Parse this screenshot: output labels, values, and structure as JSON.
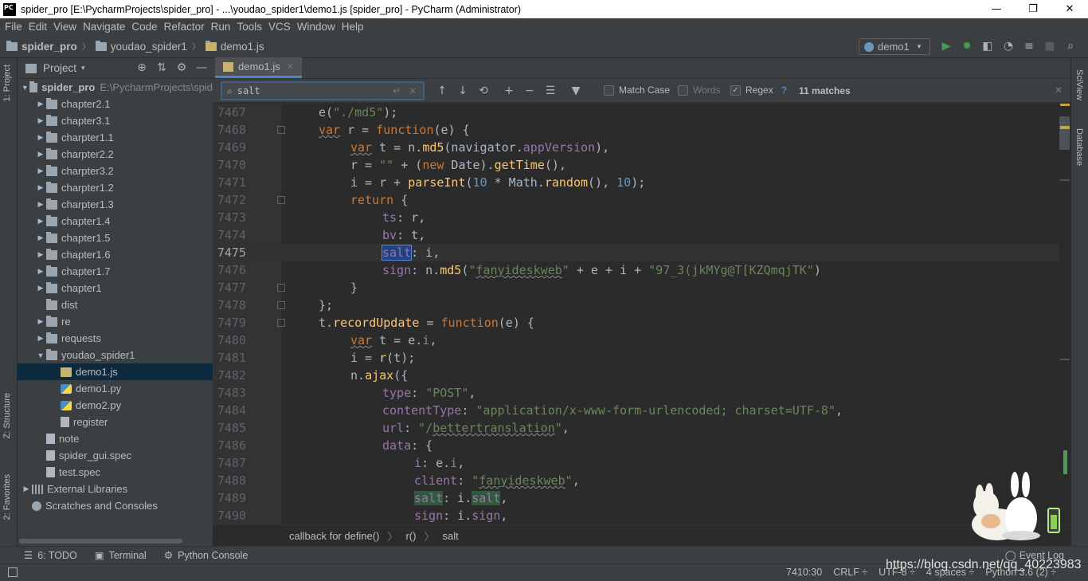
{
  "window": {
    "app_icon": "PC",
    "title": "spider_pro [E:\\PycharmProjects\\spider_pro] - ...\\youdao_spider1\\demo1.js [spider_pro] - PyCharm (Administrator)",
    "min": "—",
    "max": "❐",
    "close": "✕"
  },
  "menu": [
    "File",
    "Edit",
    "View",
    "Navigate",
    "Code",
    "Refactor",
    "Run",
    "Tools",
    "VCS",
    "Window",
    "Help"
  ],
  "breadcrumb": {
    "project": "spider_pro",
    "folder": "youdao_spider1",
    "file": "demo1.js",
    "sep": "〉"
  },
  "run_config": {
    "name": "demo1",
    "arrow": "▾"
  },
  "toolbar_icons": [
    "run-icon",
    "debug-icon",
    "coverage-icon",
    "profile-icon",
    "run-tasks-icon",
    "stop-icon",
    "search-everywhere-icon"
  ],
  "toolbar_glyphs": [
    "▶",
    "✹",
    "◧",
    "◔",
    "≡",
    "■",
    "⌕"
  ],
  "left_tabs": {
    "project": "1: Project",
    "structure": "Z: Structure",
    "favorites": "2: Favorites"
  },
  "right_tabs": {
    "sciview": "SciView",
    "database": "Database"
  },
  "project_panel": {
    "title": "Project",
    "arrow": "▾",
    "icons": [
      "⊕",
      "⇅",
      "⚙",
      "—"
    ]
  },
  "tree": [
    {
      "label": "spider_pro",
      "extra": "E:\\PycharmProjects\\spid",
      "level": 0,
      "arrow": "▼",
      "icon": "folder",
      "bold": true
    },
    {
      "label": "chapter2.1",
      "level": 1,
      "arrow": "▶",
      "icon": "folder"
    },
    {
      "label": "chapter3.1",
      "level": 1,
      "arrow": "▶",
      "icon": "folder"
    },
    {
      "label": "charpter1.1",
      "level": 1,
      "arrow": "▶",
      "icon": "folder"
    },
    {
      "label": "charpter2.2",
      "level": 1,
      "arrow": "▶",
      "icon": "folder"
    },
    {
      "label": "charpter3.2",
      "level": 1,
      "arrow": "▶",
      "icon": "folder"
    },
    {
      "label": "charpter1.2",
      "level": 1,
      "arrow": "▶",
      "icon": "folder"
    },
    {
      "label": "charpter1.3",
      "level": 1,
      "arrow": "▶",
      "icon": "folder"
    },
    {
      "label": "chapter1.4",
      "level": 1,
      "arrow": "▶",
      "icon": "folder"
    },
    {
      "label": "chapter1.5",
      "level": 1,
      "arrow": "▶",
      "icon": "folder"
    },
    {
      "label": "chapter1.6",
      "level": 1,
      "arrow": "▶",
      "icon": "folder"
    },
    {
      "label": "chapter1.7",
      "level": 1,
      "arrow": "▶",
      "icon": "folder"
    },
    {
      "label": "chapter1",
      "level": 1,
      "arrow": "▶",
      "icon": "folder"
    },
    {
      "label": "dist",
      "level": 1,
      "arrow": "",
      "icon": "folder"
    },
    {
      "label": "re",
      "level": 1,
      "arrow": "▶",
      "icon": "folder"
    },
    {
      "label": "requests",
      "level": 1,
      "arrow": "▶",
      "icon": "folder"
    },
    {
      "label": "youdao_spider1",
      "level": 1,
      "arrow": "▼",
      "icon": "folder"
    },
    {
      "label": "demo1.js",
      "level": 2,
      "arrow": "",
      "icon": "jsf",
      "selected": true
    },
    {
      "label": "demo1.py",
      "level": 2,
      "arrow": "",
      "icon": "pyf"
    },
    {
      "label": "demo2.py",
      "level": 2,
      "arrow": "",
      "icon": "pyf"
    },
    {
      "label": "register",
      "level": 2,
      "arrow": "",
      "icon": "file"
    },
    {
      "label": "note",
      "level": 1,
      "arrow": "",
      "icon": "file"
    },
    {
      "label": "spider_gui.spec",
      "level": 1,
      "arrow": "",
      "icon": "file"
    },
    {
      "label": "test.spec",
      "level": 1,
      "arrow": "",
      "icon": "file"
    },
    {
      "label": "External Libraries",
      "level": 0,
      "arrow": "▶",
      "icon": "lib"
    },
    {
      "label": "Scratches and Consoles",
      "level": 0,
      "arrow": "",
      "icon": "scratch"
    }
  ],
  "editor_tab": {
    "label": "demo1.js",
    "close": "✕"
  },
  "find": {
    "query": "salt",
    "mag": "⌕",
    "enter": "↵",
    "clear": "✕",
    "icons": [
      "↑",
      "↓",
      "⟲",
      "+",
      "−",
      "☰",
      "▼"
    ],
    "match_case": "Match Case",
    "words": "Words",
    "regex": "Regex",
    "regex_checked": "✓",
    "help": "?",
    "matches": "11 matches",
    "close": "✕"
  },
  "code_lines": [
    {
      "n": "7467",
      "html": "e(<span class=\"str\">\"./md5\"</span>);",
      "indent": 0
    },
    {
      "n": "7468",
      "html": "<span class=\"kwu\">var</span> r = <span class=\"kw\">function</span>(e) {",
      "indent": 0
    },
    {
      "n": "7469",
      "html": "<span class=\"kwu\">var</span> t = n.<span class=\"fn\">md5</span>(navigator.<span class=\"prop\">appVersion</span>),",
      "indent": 1
    },
    {
      "n": "7470",
      "html": "r = <span class=\"str\">\"\"</span> + (<span class=\"kw\">new</span> Date).<span class=\"fn\">getTime</span>(),",
      "indent": 1
    },
    {
      "n": "7471",
      "html": "i = r + <span class=\"fn\">parseInt</span>(<span class=\"num\">10</span> * Math.<span class=\"fn\">random</span>(), <span class=\"num\">10</span>);",
      "indent": 1
    },
    {
      "n": "7472",
      "html": "<span class=\"kw\">return</span> {",
      "indent": 1
    },
    {
      "n": "7473",
      "html": "<span class=\"prop\">ts</span>: r,",
      "indent": 2
    },
    {
      "n": "7474",
      "html": "<span class=\"prop\">bv</span>: t,",
      "indent": 2
    },
    {
      "n": "7475",
      "html": "<span class=\"prop hlsel\">salt</span>: i,",
      "indent": 2,
      "current": true
    },
    {
      "n": "7476",
      "html": "<span class=\"prop\">sign</span>: n.<span class=\"fn\">md5</span>(<span class=\"str\">\"<span class=\"wavy\">fanyideskweb</span>\"</span> + e + i + <span class=\"str\">\"97_3(jkMYg@T[KZQmqjTK\"</span>)",
      "indent": 2
    },
    {
      "n": "7477",
      "html": "}",
      "indent": 1
    },
    {
      "n": "7478",
      "html": "};",
      "indent": 0
    },
    {
      "n": "7479",
      "html": "t.<span class=\"fn\">recordUpdate</span> = <span class=\"kw\">function</span>(e) {",
      "indent": 0
    },
    {
      "n": "7480",
      "html": "<span class=\"kwu\">var</span> t = e.<span class=\"prop\">i</span>,",
      "indent": 1
    },
    {
      "n": "7481",
      "html": "i = <span class=\"fn\">r</span>(t);",
      "indent": 1
    },
    {
      "n": "7482",
      "html": "n.<span class=\"fn\">ajax</span>({",
      "indent": 1
    },
    {
      "n": "7483",
      "html": "<span class=\"prop\">type</span>: <span class=\"str\">\"POST\"</span>,",
      "indent": 2
    },
    {
      "n": "7484",
      "html": "<span class=\"prop\">contentType</span>: <span class=\"str\">\"application/x-www-form-urlencoded; charset=UTF-8\"</span>,",
      "indent": 2
    },
    {
      "n": "7485",
      "html": "<span class=\"prop\">url</span>: <span class=\"str\">\"/<span class=\"wavy\">bettertranslation</span>\"</span>,",
      "indent": 2
    },
    {
      "n": "7486",
      "html": "<span class=\"prop\">data</span>: {",
      "indent": 2
    },
    {
      "n": "7487",
      "html": "<span class=\"prop\">i</span>: e.<span class=\"prop\">i</span>,",
      "indent": 3
    },
    {
      "n": "7488",
      "html": "<span class=\"prop\">client</span>: <span class=\"str\">\"<span class=\"wavy\">fanyideskweb</span>\"</span>,",
      "indent": 3
    },
    {
      "n": "7489",
      "html": "<span class=\"prop hl\">salt</span>: i.<span class=\"prop hl\">salt</span>,",
      "indent": 3
    },
    {
      "n": "7490",
      "html": "<span class=\"prop\">sign</span>: i.<span class=\"prop\">sign</span>,",
      "indent": 3
    }
  ],
  "code_breadcrumb": [
    "callback for define()",
    "r()",
    "salt"
  ],
  "code_breadcrumb_sep": "〉",
  "bottom_tabs": {
    "todo": "6: TODO",
    "terminal": "Terminal",
    "python_console": "Python Console",
    "event_log": "Event Log"
  },
  "bottom_glyphs": {
    "todo": "☰",
    "terminal": "▣",
    "python_console": "⚙",
    "event_log": "◯"
  },
  "status": {
    "position": "7410:30",
    "line_sep": "CRLF ÷",
    "encoding": "UTF-8 ÷",
    "indent": "4 spaces ÷",
    "interpreter": "Python 3.6 (2) ÷"
  },
  "watermark": "https://blog.csdn.net/qq_40223983",
  "colors": {
    "accent": "#4a88c7",
    "selection": "#0d293e",
    "match": "#32593d",
    "current_match": "#214283"
  }
}
